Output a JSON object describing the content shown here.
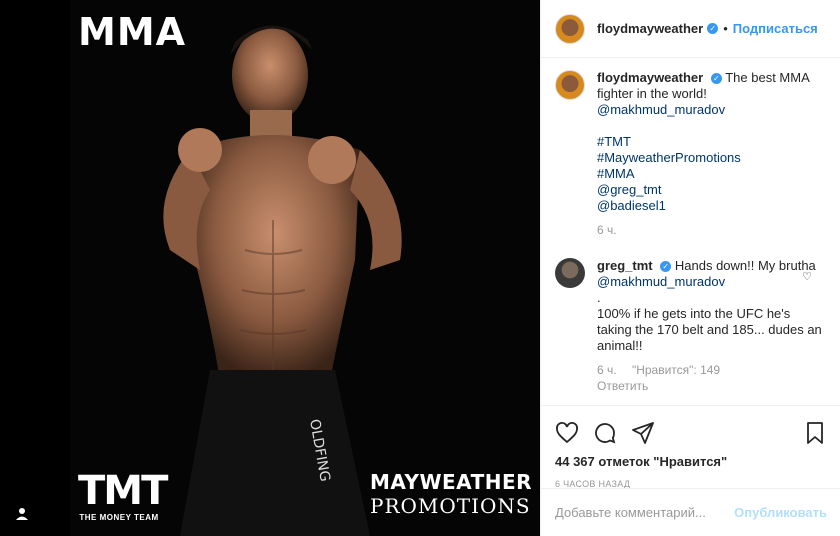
{
  "photo": {
    "mma_label": "MMA",
    "tmt_big": "TMT",
    "tmt_small": "THE MONEY TEAM",
    "promo_line1": "MAYWEATHER",
    "promo_line2": "PROMOTIONS"
  },
  "header": {
    "username": "floydmayweather",
    "separator": "•",
    "follow_label": "Подписаться"
  },
  "caption": {
    "username": "floydmayweather",
    "text": "The best MMA fighter in the world!",
    "mention": "@makhmud_muradov",
    "tags": [
      "#TMT",
      "#MayweatherPromotions",
      "#MMA"
    ],
    "mentions": [
      "@greg_tmt",
      "@badiesel1"
    ],
    "time": "6 ч."
  },
  "comment": {
    "username": "greg_tmt",
    "text_pre": "Hands down!! My brutha",
    "mention": "@makhmud_muradov",
    "dot": ".",
    "text_post": "100% if he gets into the UFC he's taking the 170 belt and 185... dudes an animal!!",
    "time": "6 ч.",
    "likes": "\"Нравится\": 149",
    "reply": "Ответить"
  },
  "actions": {
    "likes_text": "44 367 отметок \"Нравится\"",
    "timestamp": "6 часов назад"
  },
  "add_comment": {
    "placeholder": "Добавьте комментарий...",
    "publish_label": "Опубликовать"
  },
  "colors": {
    "accent": "#3897f0",
    "link": "#003569",
    "muted": "#999999"
  }
}
